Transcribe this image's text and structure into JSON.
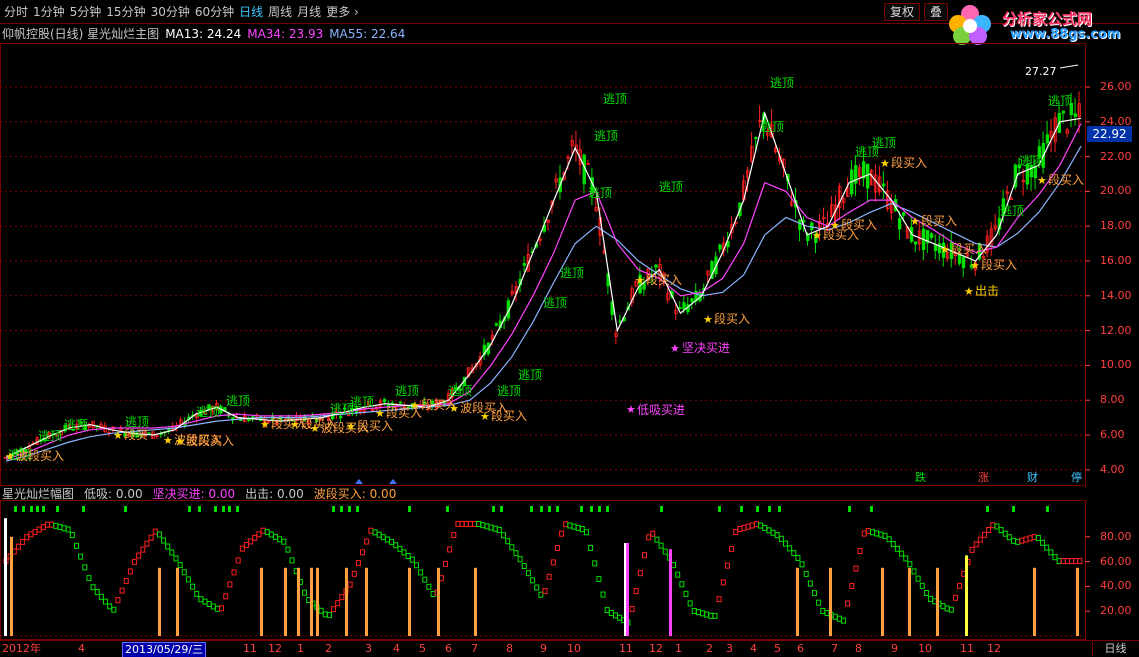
{
  "toolbar": {
    "tabs": [
      "分时",
      "1分钟",
      "5分钟",
      "15分钟",
      "30分钟",
      "60分钟",
      "日线",
      "周线",
      "月线",
      "更多"
    ],
    "active_tab": "日线",
    "more_arrow": "›",
    "reset_label": "复权",
    "overlay_label": "叠"
  },
  "brand": {
    "name": "分析家公式网",
    "url": "www.88gs.com"
  },
  "main_chart": {
    "title": "仰帆控股(日线) 星光灿烂主图",
    "ma13_label": "MA13: 24.24",
    "ma34_label": "MA34: 23.93",
    "ma55_label": "MA55: 22.64",
    "y_ticks": [
      "26.00",
      "24.00",
      "22.00",
      "20.00",
      "18.00",
      "16.00",
      "14.00",
      "12.00",
      "10.00",
      "8.00",
      "6.00",
      "4.00"
    ],
    "last_price": "22.92",
    "high_label": "27.27",
    "signal_labels": {
      "top": "逃顶",
      "band_buy": "波段买入",
      "band_buy_short": "段买入",
      "firm_buy": "坚决买进",
      "low_buy": "低吸买进",
      "strike": "出击",
      "band_buy_trunc": "段买"
    },
    "corner_labels": [
      "跌",
      "涨",
      "财",
      "停"
    ],
    "colors": {
      "up": "#ff2020",
      "down": "#00e000",
      "ma13": "#ffffff",
      "ma34": "#ff44ff",
      "ma55": "#8ab4ff",
      "signal": "#ffa040"
    }
  },
  "sub_chart": {
    "title": "星光灿烂幅图",
    "low_buy": "低吸: 0.00",
    "firm_buy": "坚决买进: 0.00",
    "strike": "出击: 0.00",
    "band_buy": "波段买入: 0.00",
    "y_ticks": [
      "80.00",
      "60.00",
      "40.00",
      "20.00"
    ]
  },
  "date_axis": {
    "ticks": [
      "2012年",
      "4",
      "11",
      "12",
      "1",
      "2",
      "3",
      "4",
      "5",
      "6",
      "7",
      "8",
      "9",
      "10",
      "11",
      "12",
      "1",
      "2",
      "3",
      "4",
      "5",
      "6",
      "7",
      "8",
      "9",
      "10",
      "11",
      "12"
    ],
    "cursor_date": "2013/05/29/三",
    "period": "日线"
  },
  "chart_data": {
    "type": "candlestick",
    "ylim": [
      4,
      27
    ],
    "ma13": [
      4.7,
      5.3,
      5.9,
      6.4,
      6.6,
      6.3,
      6.1,
      6.0,
      6.3,
      7.2,
      7.6,
      7.0,
      6.9,
      6.8,
      6.9,
      7.0,
      7.3,
      7.6,
      7.8,
      7.7,
      7.6,
      8.0,
      9.5,
      11.2,
      13.5,
      16.5,
      19.5,
      22.5,
      20.0,
      12.0,
      14.5,
      15.5,
      13.0,
      14.0,
      16.5,
      19.5,
      24.5,
      21.0,
      17.5,
      18.0,
      20.5,
      21.0,
      19.5,
      17.5,
      17.0,
      16.5,
      16.0,
      17.5,
      21.0,
      21.5,
      24.0,
      24.2
    ],
    "ma34": [
      4.6,
      5.0,
      5.5,
      6.0,
      6.3,
      6.4,
      6.4,
      6.4,
      6.5,
      6.8,
      7.1,
      7.2,
      7.1,
      7.1,
      7.1,
      7.2,
      7.3,
      7.5,
      7.6,
      7.7,
      7.7,
      7.8,
      8.5,
      10.0,
      11.8,
      14.0,
      16.5,
      19.5,
      20.0,
      17.0,
      15.5,
      15.0,
      14.0,
      14.2,
      15.0,
      17.0,
      20.5,
      20.0,
      18.5,
      18.0,
      18.8,
      19.5,
      19.5,
      18.5,
      17.8,
      17.0,
      16.5,
      16.8,
      18.5,
      19.8,
      21.5,
      23.9
    ],
    "ma55": [
      4.5,
      4.8,
      5.2,
      5.6,
      5.9,
      6.1,
      6.2,
      6.3,
      6.4,
      6.6,
      6.8,
      6.9,
      7.0,
      7.0,
      7.0,
      7.1,
      7.2,
      7.3,
      7.4,
      7.5,
      7.6,
      7.7,
      8.0,
      9.0,
      10.5,
      12.5,
      14.8,
      17.0,
      18.0,
      17.2,
      16.0,
      15.2,
      14.4,
      14.0,
      14.2,
      15.2,
      17.5,
      18.5,
      18.0,
      17.8,
      18.2,
      18.8,
      19.3,
      18.8,
      18.2,
      17.6,
      17.0,
      16.8,
      17.6,
      18.8,
      20.5,
      22.6
    ],
    "sub_series": [
      60,
      80,
      90,
      85,
      40,
      20,
      60,
      85,
      60,
      30,
      20,
      70,
      85,
      75,
      30,
      15,
      40,
      85,
      75,
      60,
      30,
      90,
      90,
      85,
      60,
      30,
      90,
      85,
      20,
      10,
      85,
      60,
      20,
      15,
      85,
      90,
      80,
      60,
      20,
      12,
      85,
      80,
      60,
      30,
      20,
      70,
      90,
      75,
      80,
      60,
      60
    ]
  }
}
